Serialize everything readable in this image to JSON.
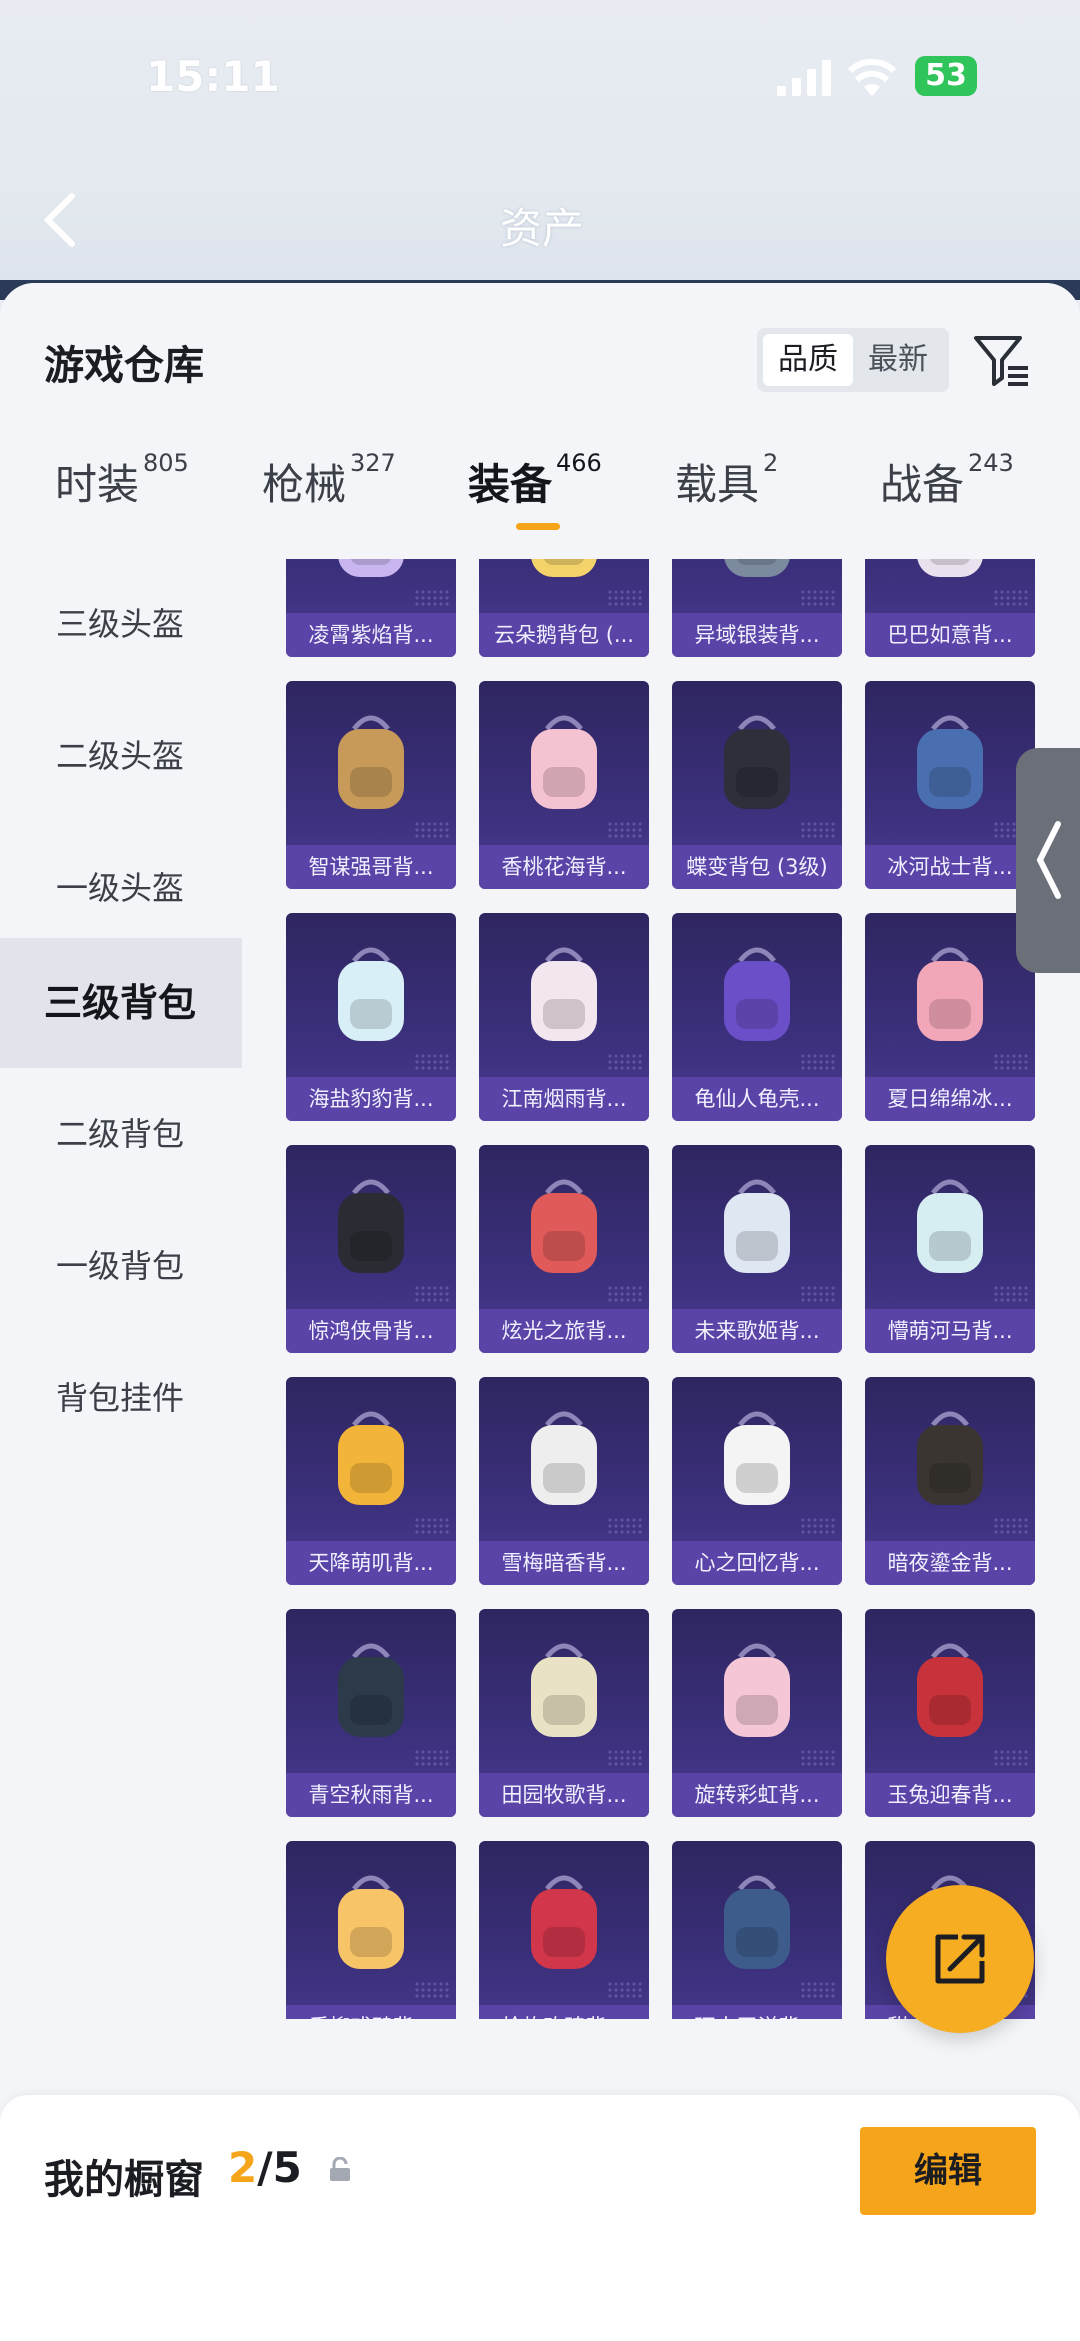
{
  "status_bar": {
    "time": "15:11",
    "battery": "53"
  },
  "nav": {
    "title": "资产"
  },
  "sheet": {
    "title": "游戏仓库",
    "sort": {
      "active": "品质",
      "inactive": "最新"
    }
  },
  "tabs": [
    {
      "label": "时装",
      "count": "805"
    },
    {
      "label": "枪械",
      "count": "327"
    },
    {
      "label": "装备",
      "count": "466"
    },
    {
      "label": "载具",
      "count": "2"
    },
    {
      "label": "战备",
      "count": "243"
    }
  ],
  "sidebar": [
    {
      "label": "三级头盔"
    },
    {
      "label": "二级头盔"
    },
    {
      "label": "一级头盔"
    },
    {
      "label": "三级背包"
    },
    {
      "label": "二级背包"
    },
    {
      "label": "一级背包"
    },
    {
      "label": "背包挂件"
    }
  ],
  "items": [
    "凌霄紫焰背...",
    "云朵鹅背包 (...",
    "异域银装背...",
    "巴巴如意背...",
    "智谋强哥背...",
    "香桃花海背...",
    "蝶变背包 (3级)",
    "冰河战士背...",
    "海盐豹豹背...",
    "江南烟雨背...",
    "龟仙人龟壳...",
    "夏日绵绵冰...",
    "惊鸿侠骨背...",
    "炫光之旅背...",
    "未来歌姬背...",
    "懵萌河马背...",
    "天降萌叽背...",
    "雪梅暗香背...",
    "心之回忆背...",
    "暗夜鎏金背...",
    "青空秋雨背...",
    "田园牧歌背...",
    "旋转彩虹背...",
    "玉兔迎春背...",
    "垂柳戏鸭背...",
    "枪炮玫瑰背...",
    "环太平洋背...",
    "甜心亚梦背..."
  ],
  "item_icons": [
    "backpack-icon"
  ],
  "bottom": {
    "title": "我的橱窗",
    "count_current": "2",
    "count_sep": "/",
    "count_total": "5",
    "edit_label": "编辑"
  },
  "colors": {
    "accent": "#f6a51a",
    "card": "#3a2f7a",
    "label": "#5a44a8"
  }
}
